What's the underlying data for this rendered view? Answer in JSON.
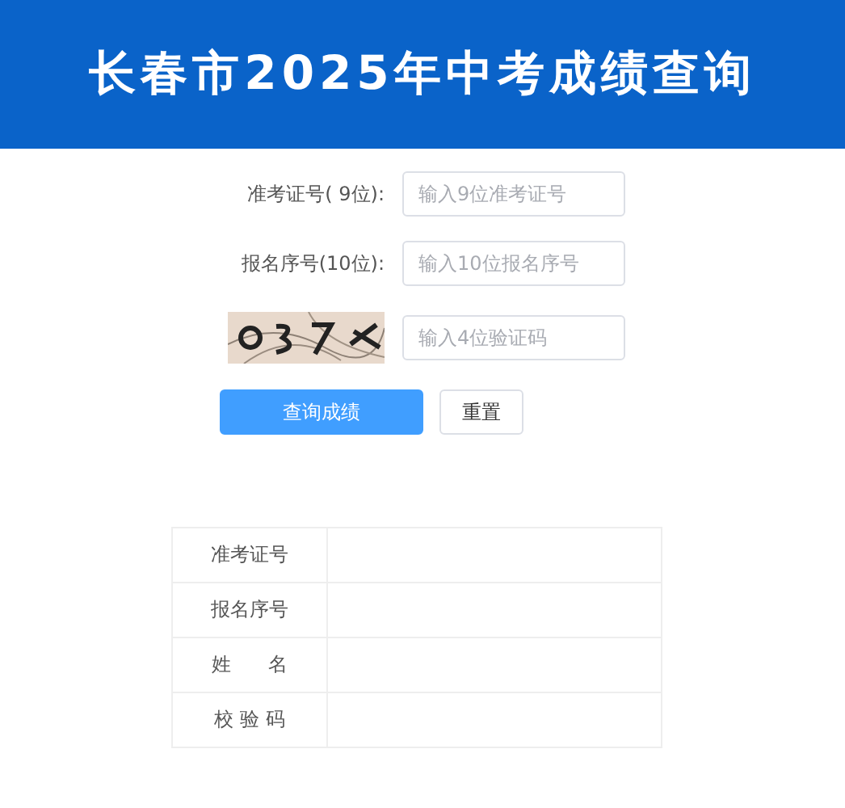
{
  "header": {
    "title": "长春市2025年中考成绩查询"
  },
  "form": {
    "fields": [
      {
        "kind": "text",
        "label": "准考证号( 9位):",
        "placeholder": "输入9位准考证号"
      },
      {
        "kind": "text",
        "label": "报名序号(10位):",
        "placeholder": "输入10位报名序号"
      },
      {
        "kind": "captcha",
        "placeholder": "输入4位验证码"
      }
    ],
    "buttons": [
      {
        "kind": "primary",
        "label": "查询成绩"
      },
      {
        "kind": "plain",
        "label": "重置"
      }
    ]
  },
  "result_table": {
    "rows": [
      {
        "label": "准考证号"
      },
      {
        "label": "报名序号"
      },
      {
        "label": "姓      名"
      },
      {
        "label": "校 验 码"
      }
    ]
  }
}
